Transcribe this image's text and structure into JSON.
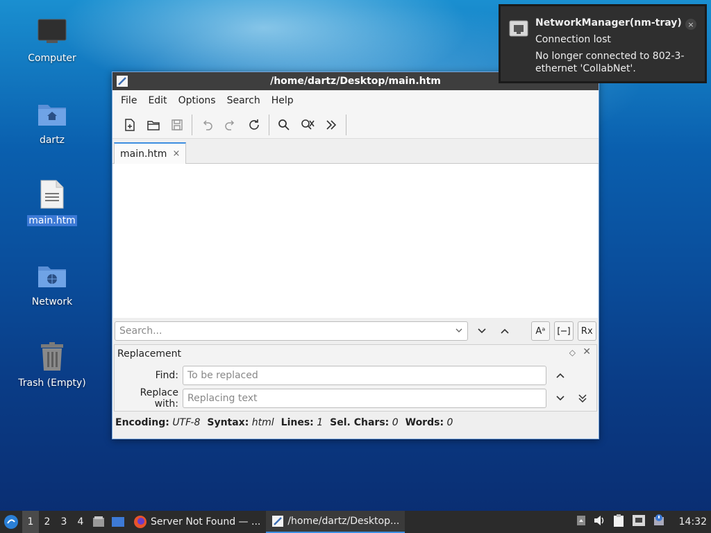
{
  "desktop": {
    "icons": [
      {
        "label": "Computer",
        "icon": "computer-icon"
      },
      {
        "label": "dartz",
        "icon": "home-folder-icon"
      },
      {
        "label": "main.htm",
        "icon": "text-file-icon"
      },
      {
        "label": "Network",
        "icon": "network-folder-icon"
      },
      {
        "label": "Trash (Empty)",
        "icon": "trash-icon"
      }
    ]
  },
  "window": {
    "title": "/home/dartz/Desktop/main.htm",
    "menu": [
      "File",
      "Edit",
      "Options",
      "Search",
      "Help"
    ],
    "toolbar_icons": [
      "new-file-icon",
      "open-folder-icon",
      "save-icon",
      "undo-icon",
      "redo-icon",
      "reload-icon",
      "find-icon",
      "find-replace-icon",
      "more-icon"
    ],
    "tab": {
      "label": "main.htm",
      "close": "×"
    },
    "search": {
      "placeholder": "Search...",
      "case_btn": "Aᵃ",
      "regex_btn": "Rx"
    },
    "replacement": {
      "title": "Replacement",
      "find_label": "Find:",
      "find_placeholder": "To be replaced",
      "replace_label": "Replace with:",
      "replace_placeholder": "Replacing text"
    },
    "status": {
      "encoding_label": "Encoding:",
      "encoding": "UTF-8",
      "syntax_label": "Syntax:",
      "syntax": "html",
      "lines_label": "Lines:",
      "lines": "1",
      "selchars_label": "Sel. Chars:",
      "selchars": "0",
      "words_label": "Words:",
      "words": "0"
    }
  },
  "notification": {
    "title": "NetworkManager(nm-tray)",
    "summary": "Connection lost",
    "body": "No longer connected to 802-3-ethernet 'CollabNet'.",
    "close": "×"
  },
  "taskbar": {
    "workspaces": [
      "1",
      "2",
      "3",
      "4"
    ],
    "tasks": [
      {
        "label": "Server Not Found — ...",
        "icon": "firefox-icon"
      },
      {
        "label": "/home/dartz/Desktop...",
        "icon": "text-editor-icon"
      }
    ],
    "clock": "14:32"
  },
  "colors": {
    "accent": "#3d8ee0",
    "selection": "#3d7ad6",
    "titlebar": "#3e3e3e"
  }
}
